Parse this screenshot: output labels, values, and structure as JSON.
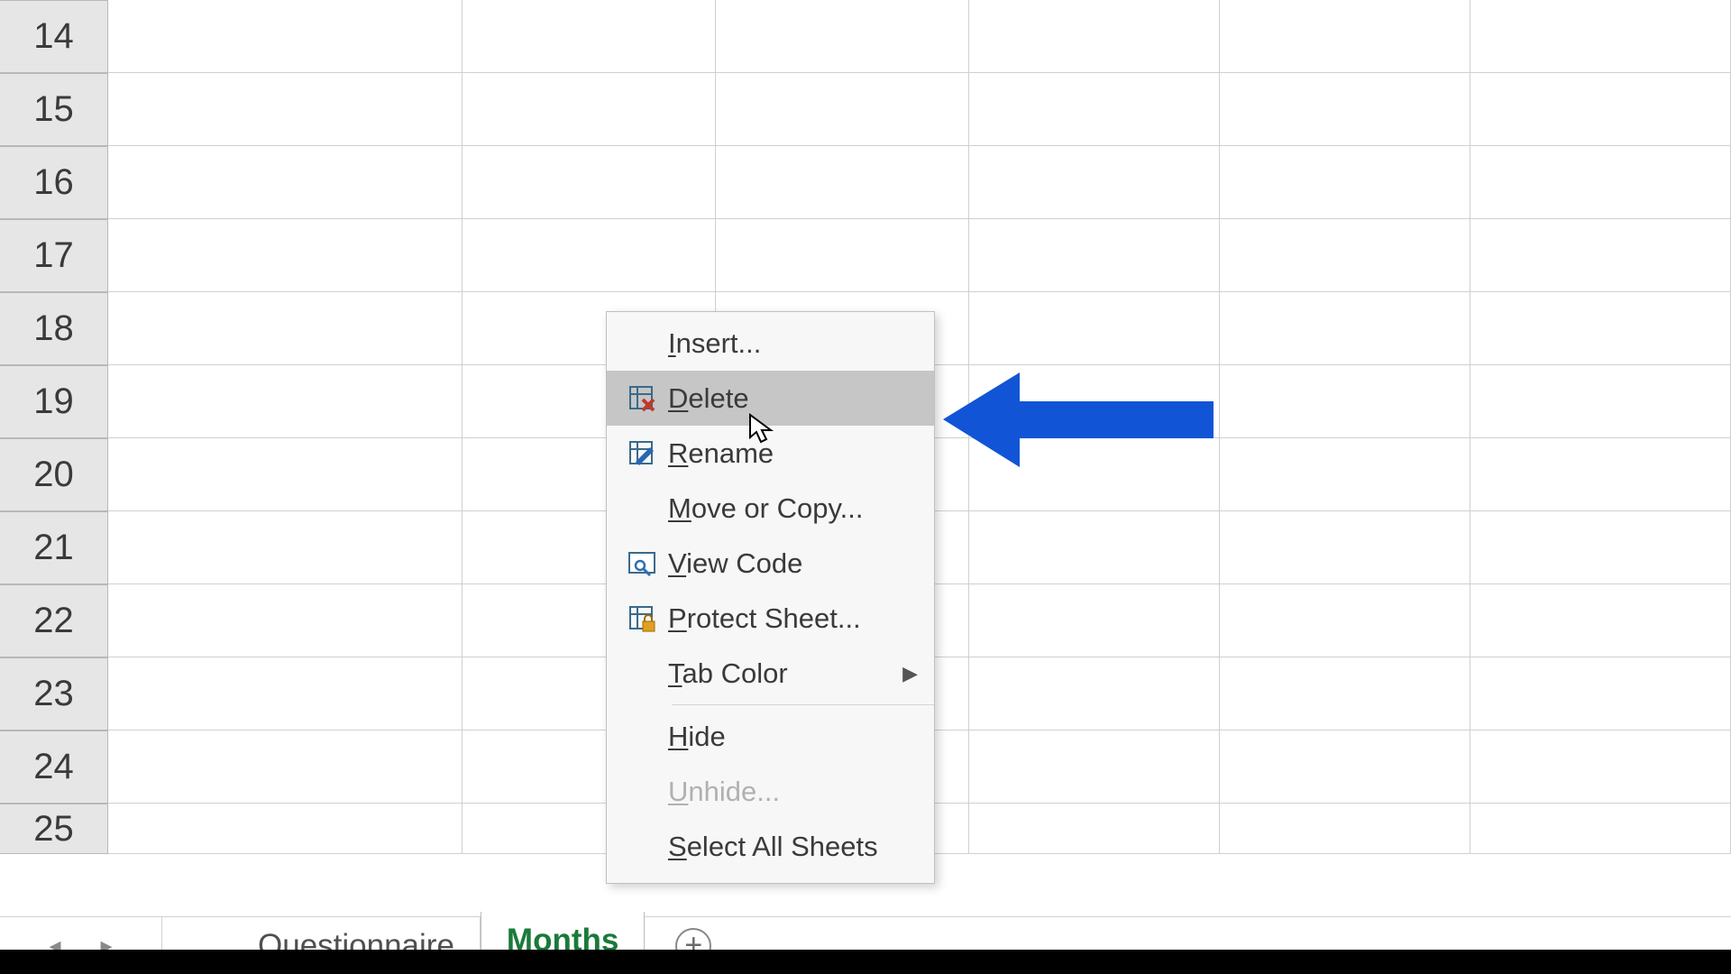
{
  "rows": {
    "start": 14,
    "end": 25
  },
  "tabs": {
    "items": [
      {
        "label": "Questionnaire",
        "active": false
      },
      {
        "label": "Months",
        "active": true
      }
    ],
    "nav_prev": "◂",
    "nav_next": "▸",
    "add_glyph": "+"
  },
  "context_menu": {
    "items": [
      {
        "id": "insert",
        "label": "Insert...",
        "underline_index": 0,
        "icon": "",
        "has_submenu": false,
        "disabled": false,
        "hover": false
      },
      {
        "id": "delete",
        "label": "Delete",
        "underline_index": 0,
        "icon": "delete-sheet",
        "has_submenu": false,
        "disabled": false,
        "hover": true
      },
      {
        "id": "rename",
        "label": "Rename",
        "underline_index": 0,
        "icon": "rename-sheet",
        "has_submenu": false,
        "disabled": false,
        "hover": false
      },
      {
        "id": "moveorcopy",
        "label": "Move or Copy...",
        "underline_index": 0,
        "icon": "",
        "has_submenu": false,
        "disabled": false,
        "hover": false
      },
      {
        "id": "viewcode",
        "label": "View Code",
        "underline_index": 0,
        "icon": "view-code",
        "has_submenu": false,
        "disabled": false,
        "hover": false
      },
      {
        "id": "protectsheet",
        "label": "Protect Sheet...",
        "underline_index": 0,
        "icon": "protect-sheet",
        "has_submenu": false,
        "disabled": false,
        "hover": false
      },
      {
        "id": "tabcolor",
        "label": "Tab Color",
        "underline_index": 0,
        "icon": "",
        "has_submenu": true,
        "disabled": false,
        "hover": false
      },
      {
        "id": "hide",
        "label": "Hide",
        "underline_index": 0,
        "icon": "",
        "has_submenu": false,
        "disabled": false,
        "hover": false
      },
      {
        "id": "unhide",
        "label": "Unhide...",
        "underline_index": 0,
        "icon": "",
        "has_submenu": false,
        "disabled": true,
        "hover": false
      },
      {
        "id": "selectall",
        "label": "Select All Sheets",
        "underline_index": 0,
        "icon": "",
        "has_submenu": false,
        "disabled": false,
        "hover": false
      }
    ],
    "separators_after": [
      "tabcolor"
    ]
  },
  "annotation": {
    "color": "#1155d6"
  }
}
